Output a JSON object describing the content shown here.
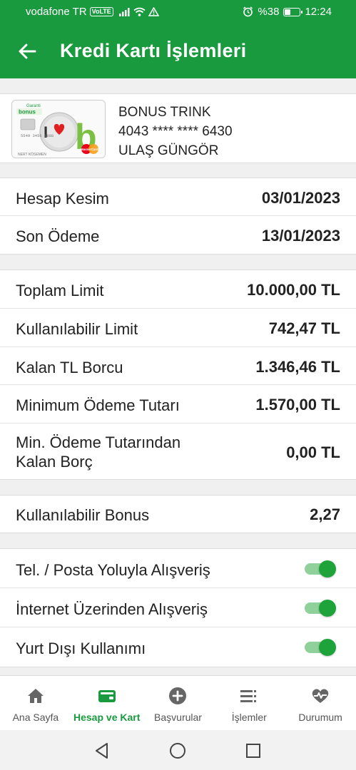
{
  "status_bar": {
    "carrier": "vodafone TR",
    "volte": "VoLTE",
    "battery_text": "%38",
    "battery_level": 0.38,
    "time": "12:24"
  },
  "app_bar": {
    "title": "Kredi Kartı İşlemleri",
    "back_icon": "arrow-left-icon"
  },
  "card": {
    "name": "BONUS TRINK",
    "number": "4043 **** **** 6430",
    "holder": "ULAŞ GÜNGÖR",
    "thumb": {
      "bank_text": "Garanti",
      "brand_text": "bonus",
      "love_letter": "I",
      "b_letter": "b",
      "card_digits": "5549 3456 1888",
      "holder_text": "NERT KÖSEMEN",
      "network_text": "MasterCard"
    }
  },
  "dates": [
    {
      "label": "Hesap Kesim",
      "value": "03/01/2023"
    },
    {
      "label": "Son Ödeme",
      "value": "13/01/2023"
    }
  ],
  "amounts": [
    {
      "label": "Toplam Limit",
      "value": "10.000,00 TL"
    },
    {
      "label": "Kullanılabilir Limit",
      "value": "742,47 TL"
    },
    {
      "label": "Kalan TL Borcu",
      "value": "1.346,46 TL"
    },
    {
      "label": "Minimum Ödeme Tutarı",
      "value": "1.570,00 TL"
    },
    {
      "label_line1": "Min. Ödeme Tutarından",
      "label_line2": "Kalan Borç",
      "value": "0,00 TL"
    }
  ],
  "bonus": {
    "label": "Kullanılabilir Bonus",
    "value": "2,27"
  },
  "toggles": [
    {
      "label": "Tel. / Posta Yoluyla Alışveriş",
      "on": true
    },
    {
      "label": "İnternet Üzerinden Alışveriş",
      "on": true
    },
    {
      "label": "Yurt Dışı Kullanımı",
      "on": true
    }
  ],
  "bottom_nav": [
    {
      "label": "Ana Sayfa",
      "icon": "home-icon",
      "active": false
    },
    {
      "label": "Hesap ve Kart",
      "icon": "wallet-icon",
      "active": true
    },
    {
      "label": "Başvurular",
      "icon": "plus-circle-icon",
      "active": false
    },
    {
      "label": "İşlemler",
      "icon": "list-icon",
      "active": false
    },
    {
      "label": "Durumum",
      "icon": "heart-pulse-icon",
      "active": false
    }
  ],
  "colors": {
    "primary": "#1a9a3f",
    "toggle_on": "#1ea33a",
    "toggle_track": "#8fd09b",
    "background": "#f0f0f0"
  }
}
